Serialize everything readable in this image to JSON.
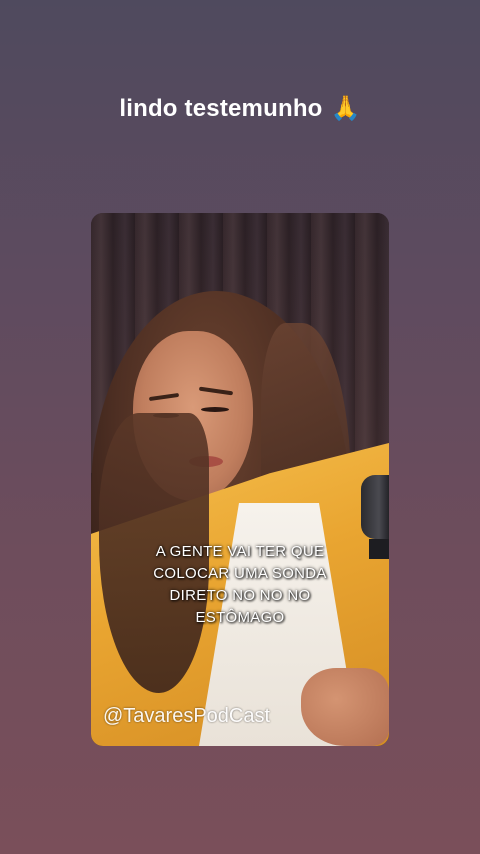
{
  "story": {
    "caption": "lindo testemunho",
    "caption_emoji": "🙏"
  },
  "video": {
    "subtitle_lines": [
      "A GENTE VAI TER QUE",
      "COLOCAR UMA SONDA",
      "DIRETO NO NO NO",
      "ESTÔMAGO"
    ],
    "watermark": "@TavaresPodCast"
  },
  "colors": {
    "background_top": "#4f4a5e",
    "background_bottom": "#7a4f5a",
    "blazer": "#f6c04e"
  }
}
